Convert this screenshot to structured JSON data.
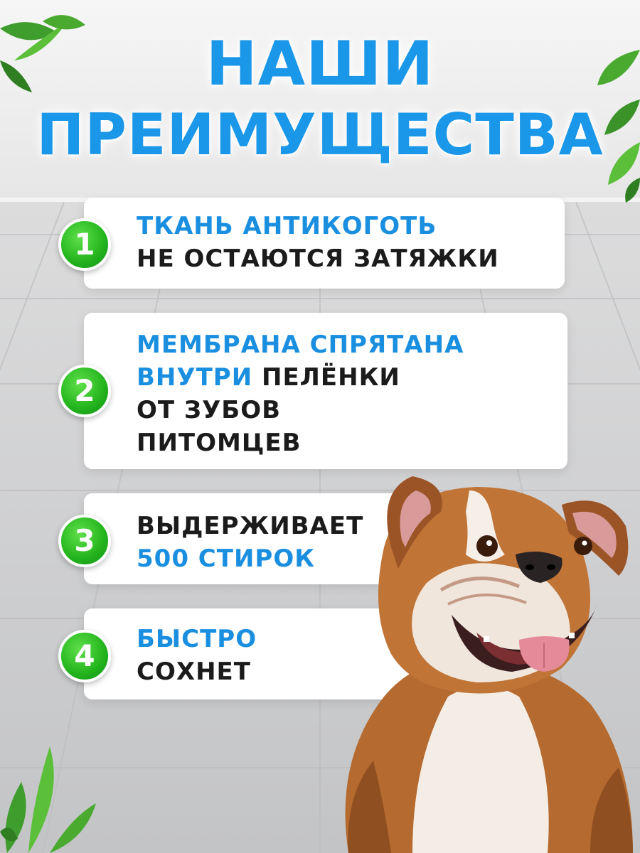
{
  "title": {
    "line1": "НАШИ",
    "line2": "ПРЕИМУЩЕСТВА"
  },
  "benefits": [
    {
      "number": "1",
      "lines": [
        [
          {
            "text": "ТКАНЬ АНТИКОГОТЬ",
            "color": "blue"
          }
        ],
        [
          {
            "text": "НЕ ОСТАЮТСЯ ЗАТЯЖКИ",
            "color": "black"
          }
        ]
      ]
    },
    {
      "number": "2",
      "lines": [
        [
          {
            "text": "МЕМБРАНА СПРЯТАНА",
            "color": "blue"
          }
        ],
        [
          {
            "text": "ВНУТРИ",
            "color": "blue"
          },
          {
            "text": " ПЕЛЁНКИ",
            "color": "black"
          }
        ],
        [
          {
            "text": "ОТ ЗУБОВ",
            "color": "black"
          }
        ],
        [
          {
            "text": "ПИТОМЦЕВ",
            "color": "black"
          }
        ]
      ]
    },
    {
      "number": "3",
      "lines": [
        [
          {
            "text": "ВЫДЕРЖИВАЕТ",
            "color": "black"
          }
        ],
        [
          {
            "text": "500 СТИРОК",
            "color": "blue"
          }
        ]
      ]
    },
    {
      "number": "4",
      "lines": [
        [
          {
            "text": "БЫСТРО",
            "color": "blue"
          }
        ],
        [
          {
            "text": "СОХНЕТ",
            "color": "black"
          }
        ]
      ]
    }
  ],
  "colors": {
    "accent_blue": "#1a8fe0",
    "badge_green": "#22b31c",
    "text_dark": "#1b1b1b"
  },
  "images": {
    "dog": "english-bulldog-photo",
    "leaves": "green-leaves-decoration"
  }
}
